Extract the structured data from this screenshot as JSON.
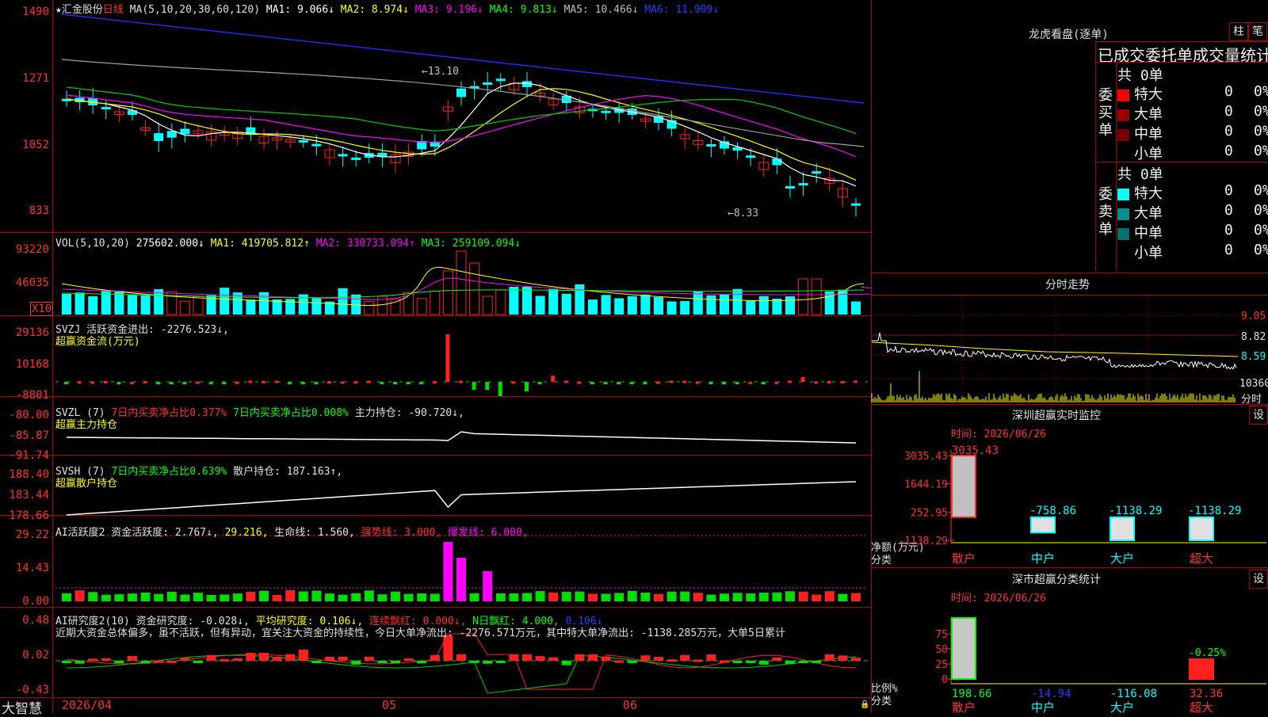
{
  "stock": {
    "name": "★汇金股份",
    "period": "日线",
    "ma_params": "MA(5,10,20,30,60,120)",
    "ma1": "MA1: 9.066↓",
    "ma2": "MA2: 8.974↓",
    "ma3": "MA3: 9.196↓",
    "ma4": "MA4: 9.813↓",
    "ma5": "MA5: 10.466↓",
    "ma6": "MA6: 11.909↓",
    "high_mark": "←13.10",
    "low_mark": "←8.33",
    "axis": [
      "1490",
      "1271",
      "1052",
      "833"
    ]
  },
  "volume": {
    "params": "VOL(5,10,20)",
    "value": "275602.000↓",
    "ma1": "MA1: 419705.812↑",
    "ma2": "MA2: 330733.094↑",
    "ma3": "MA3: 259109.094↓",
    "axis": [
      "93220",
      "46035"
    ],
    "unit": "X10"
  },
  "svzj": {
    "line1": "SVZJ  活跃资金进出: -2276.523↓,",
    "line2": "超赢资金流(万元)",
    "axis": [
      "29136",
      "10168",
      "-8801"
    ]
  },
  "svzl": {
    "name": "SVZL (7)",
    "p1": "7日内买卖净占比0.377%",
    "p2": "7日内买卖净占比0.008%",
    "p3": "主力持仓: -90.720↓,",
    "line2": "超赢主力持仓",
    "axis": [
      "-80.00",
      "-85.87",
      "-91.74"
    ]
  },
  "svsh": {
    "name": "SVSH (7)",
    "p1": "7日内买卖净占比0.639%",
    "p2": "散户持仓: 187.163↑,",
    "line2": "超赢散户持仓",
    "axis": [
      "188.40",
      "183.44",
      "178.66"
    ]
  },
  "ai_active": {
    "p1": "AI活跃度2 资金活跃度: 2.767↓,",
    "p2": "29.216,",
    "p3": "生命线: 1.560,",
    "p4": "强势线: 3.000,",
    "p5": "爆发线: 6.000,",
    "axis": [
      "29.22",
      "14.43",
      "0.00"
    ]
  },
  "ai_research": {
    "p1": "AI研究度2(10) 资金研究度: -0.028↓,",
    "p2": "平均研究度: 0.106↓,",
    "p3": "连续飘红: 0.000↓,",
    "p4": "N日飘红: 4.000,",
    "p5": "0.106↓",
    "text": "近期大资金总体偏多，虽不活跃，但有异动，宜关注大资金的持续性，今日大单净流出: -2276.571万元，其中特大单净流出: -1138.285万元，大单5日累计",
    "axis": [
      "0.48",
      "0.02",
      "-0.43"
    ]
  },
  "footer": {
    "brand": "大智慧",
    "d1": "2026/04",
    "d2": "05",
    "d3": "06"
  },
  "lhb": {
    "title": "龙虎看盘(逐单)",
    "btn1": "柱",
    "btn2": "笔",
    "subtitle": "已成交委托单成交量统计",
    "buy_side": "委买单",
    "sell_side": "委卖单",
    "buy_total": "共 0单",
    "sell_total": "共 0单",
    "rows": [
      {
        "label": "特大",
        "count": "0",
        "pct": "0%"
      },
      {
        "label": "大单",
        "count": "0",
        "pct": "0%"
      },
      {
        "label": "中单",
        "count": "0",
        "pct": "0%"
      },
      {
        "label": "小单",
        "count": "0",
        "pct": "0%"
      }
    ],
    "buy_colors": [
      "#ff0000",
      "#9a0000",
      "#7a0000"
    ],
    "sell_colors": [
      "#00ffff",
      "#009090",
      "#007070"
    ]
  },
  "intraday": {
    "title": "分时走势",
    "axis": [
      "9.05",
      "8.82",
      "8.59",
      "10360",
      "分时"
    ]
  },
  "sz_monitor": {
    "title": "深圳超赢实时监控",
    "btn": "设",
    "time": "时间: 2026/06/26",
    "axis": [
      "3035.43",
      "1644.19",
      "252.95",
      "-1138.29"
    ],
    "y_label1": "净额(万元)",
    "y_label2": "分类",
    "categories": [
      "散户",
      "中户",
      "大户",
      "超大"
    ],
    "values": [
      3035.43,
      -758.86,
      -1138.29,
      -1138.29
    ],
    "value_labels": [
      "3035.43",
      "-758.86",
      "-1138.29",
      "-1138.29"
    ]
  },
  "sz_class": {
    "title": "深市超赢分类统计",
    "btn": "设",
    "time": "时间: 2026/06/26",
    "axis": [
      "75",
      "50",
      "25",
      "0"
    ],
    "y_label1": "比例%",
    "y_label2": "分类",
    "categories": [
      "散户",
      "中户",
      "大户",
      "超大"
    ],
    "values": [
      198.66,
      -14.94,
      -116.08,
      32.36
    ],
    "value_labels": [
      "198.66",
      "-14.94",
      "-116.08",
      "32.36"
    ],
    "top_label": "-0.25%"
  }
}
